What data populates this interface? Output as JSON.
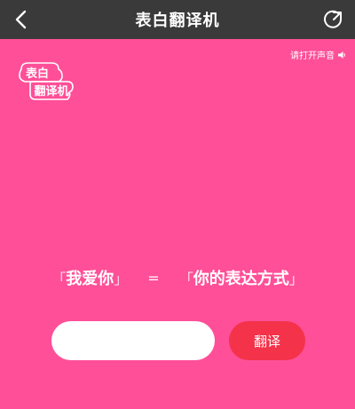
{
  "header": {
    "title": "表白翻译机"
  },
  "sound_toggle": {
    "label": "请打开声音"
  },
  "logo": {
    "line1": "表白",
    "line2": "翻译机"
  },
  "phrase": {
    "left": "我爱你",
    "equals": "=",
    "right": "你的表达方式"
  },
  "input": {
    "value": "",
    "placeholder": ""
  },
  "translate_button": {
    "label": "翻译"
  },
  "colors": {
    "background": "#ff4f98",
    "topbar": "#3a3a3a",
    "button": "#f4324a"
  }
}
